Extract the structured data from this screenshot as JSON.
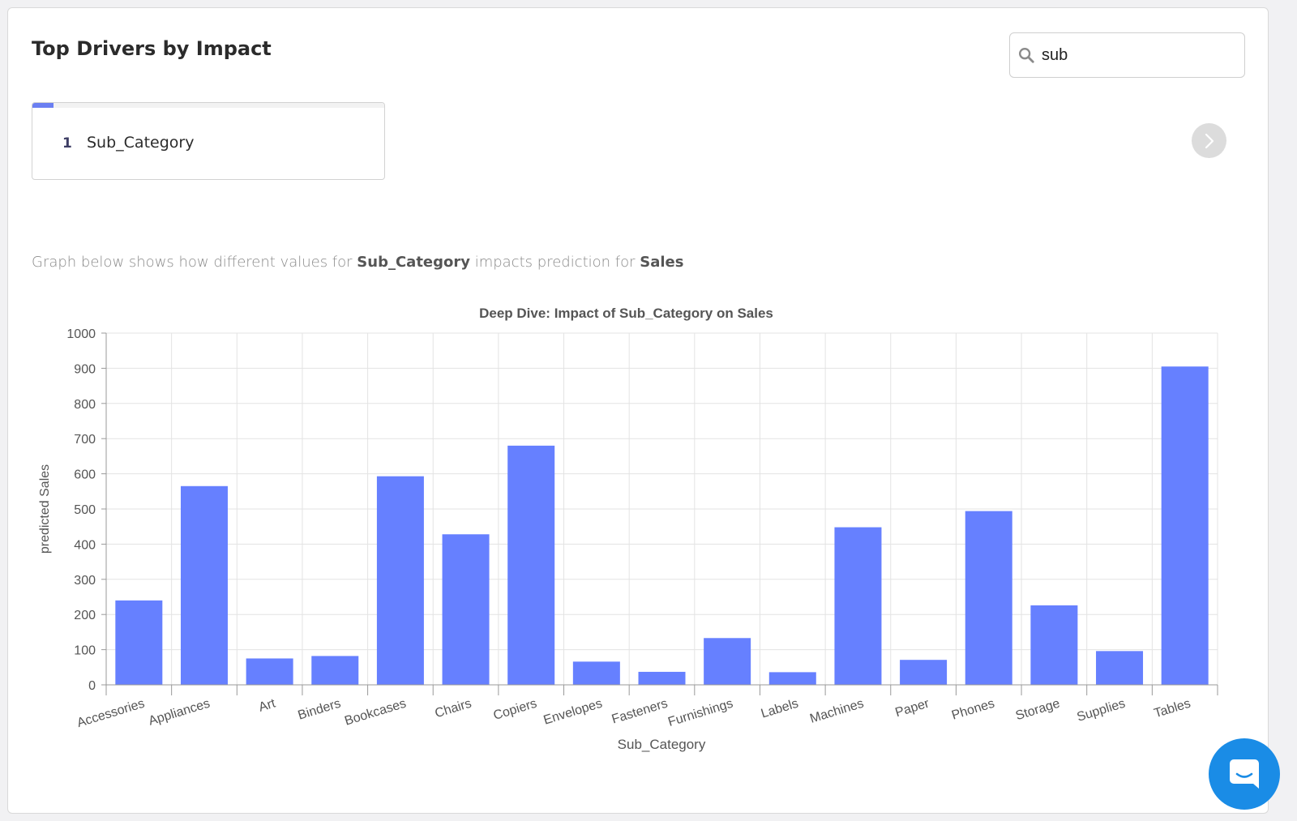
{
  "header": {
    "title": "Top Drivers by Impact"
  },
  "search": {
    "value": "sub",
    "icon": "search-icon"
  },
  "drivers": [
    {
      "rank": "1",
      "name": "Sub_Category",
      "impact_fraction": 0.06
    }
  ],
  "description": {
    "prefix": "Graph below shows how different values for ",
    "feature": "Sub_Category",
    "middle": " impacts prediction for ",
    "target": "Sales"
  },
  "colors": {
    "bar": "#6680ff",
    "accent": "#6b7ff2",
    "chat": "#1a8ce6"
  },
  "chart_data": {
    "type": "bar",
    "title": "Deep Dive: Impact of Sub_Category on Sales",
    "xlabel": "Sub_Category",
    "ylabel": "predicted Sales",
    "ylim": [
      0,
      1000
    ],
    "yticks": [
      0,
      100,
      200,
      300,
      400,
      500,
      600,
      700,
      800,
      900,
      1000
    ],
    "grid": true,
    "categories": [
      "Accessories",
      "Appliances",
      "Art",
      "Binders",
      "Bookcases",
      "Chairs",
      "Copiers",
      "Envelopes",
      "Fasteners",
      "Furnishings",
      "Labels",
      "Machines",
      "Paper",
      "Phones",
      "Storage",
      "Supplies",
      "Tables"
    ],
    "values": [
      240,
      565,
      75,
      82,
      593,
      428,
      680,
      66,
      37,
      133,
      36,
      448,
      71,
      494,
      226,
      96,
      905
    ]
  }
}
